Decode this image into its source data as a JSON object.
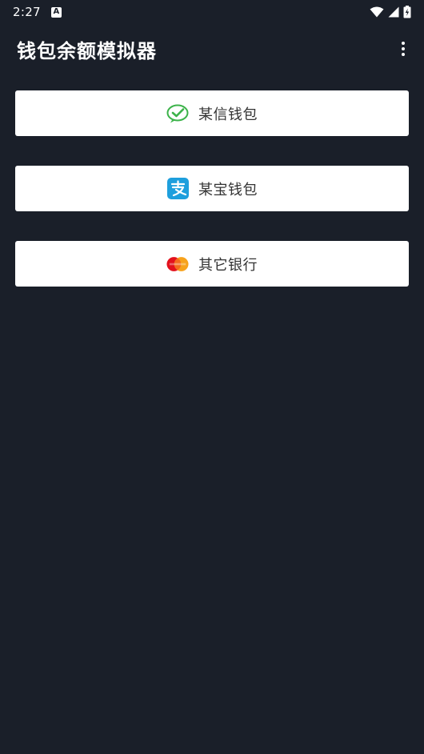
{
  "status_bar": {
    "time": "2:27",
    "notification_glyph": "A",
    "icons": [
      "wifi-icon",
      "cellular-signal-icon",
      "battery-charging-icon"
    ]
  },
  "app_bar": {
    "title": "钱包余额模拟器",
    "overflow_icon": "more-vert-icon"
  },
  "wallets": [
    {
      "label": "某信钱包",
      "icon": "wechat-pay-icon",
      "icon_color": "#3cb34a"
    },
    {
      "label": "某宝钱包",
      "icon": "alipay-icon",
      "icon_color": "#1e9fdd"
    },
    {
      "label": "其它银行",
      "icon": "mastercard-icon",
      "icon_color": "#e3101c"
    }
  ],
  "colors": {
    "background": "#1a1f29",
    "card": "#ffffff",
    "text_light": "#ffffff",
    "text_dark": "#333333"
  }
}
